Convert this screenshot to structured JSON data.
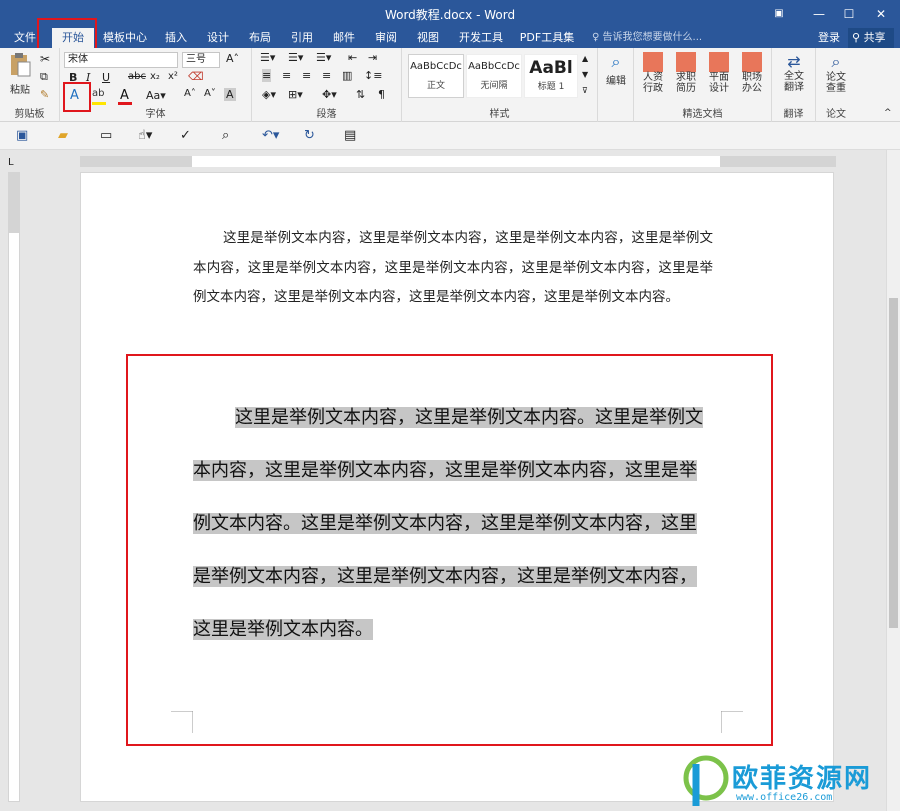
{
  "window": {
    "title": "Word教程.docx - Word"
  },
  "tabs": {
    "file": "文件",
    "home": "开始",
    "template": "模板中心",
    "insert": "插入",
    "design": "设计",
    "layout": "布局",
    "references": "引用",
    "mailings": "邮件",
    "review": "审阅",
    "view": "视图",
    "developer": "开发工具",
    "pdf": "PDF工具集"
  },
  "tellme": "告诉我您想要做什么...",
  "login": "登录",
  "share": "共享",
  "clipboard": {
    "paste": "粘贴",
    "label": "剪贴板"
  },
  "font": {
    "name": "宋体",
    "size": "三号",
    "label": "字体",
    "aa": "Aa"
  },
  "paragraph": {
    "label": "段落"
  },
  "styles": {
    "label": "样式",
    "items": [
      {
        "preview": "AaBbCcDc",
        "name": "正文"
      },
      {
        "preview": "AaBbCcDc",
        "name": "无间隔"
      },
      {
        "preview": "AaBl",
        "name": "标题 1"
      }
    ]
  },
  "editing": {
    "label": "编辑"
  },
  "templates": {
    "label": "精选文档",
    "items": [
      "人资\n行政",
      "求职\n简历",
      "平面\n设计",
      "职场\n办公"
    ]
  },
  "translate": {
    "btn": "全文\n翻译",
    "label": "翻译"
  },
  "paper": {
    "btn": "论文\n查重",
    "label": "论文"
  },
  "document": {
    "para1": "这里是举例文本内容，这里是举例文本内容，这里是举例文本内容，这里是举例文本内容，这里是举例文本内容，这里是举例文本内容，这里是举例文本内容，这里是举例文本内容，这里是举例文本内容，这里是举例文本内容，这里是举例文本内容。",
    "para2": "这里是举例文本内容，这里是举例文本内容。这里是举例文本内容，这里是举例文本内容，这里是举例文本内容，这里是举例文本内容。这里是举例文本内容，这里是举例文本内容，这里是举例文本内容，这里是举例文本内容，这里是举例文本内容，这里是举例文本内容。"
  },
  "watermark": {
    "name": "欧菲资源网",
    "url": "www.office26.com"
  },
  "colors": {
    "accent": "#2b579a",
    "highlight": "#e0161c",
    "selection": "#c6c6c6",
    "logo": "#1a9bd7"
  }
}
